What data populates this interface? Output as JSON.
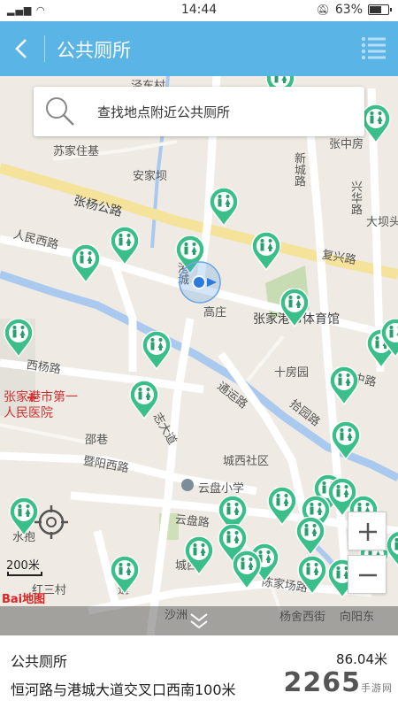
{
  "status_bar": {
    "time": "14:44",
    "battery": "63%",
    "battery_level": 0.63
  },
  "header": {
    "title": "公共厕所"
  },
  "search": {
    "placeholder": "查找地点附近公共厕所"
  },
  "map": {
    "labels": {
      "sujiazhuang": "苏家住基",
      "anjiaba": "安家坝",
      "zhangyang_rd": "张杨公路",
      "renmin_rd": "人民西路",
      "gaozhuang": "高庄",
      "stadium": "张家港市体育馆",
      "xiyang_rd": "西杨路",
      "hospital": "张家港市第一人民医院",
      "shifangyuan": "十房园",
      "tongyun_rd": "通运路",
      "bugang": "邵巷",
      "jiyang_rd": "暨阳西路",
      "chengxi": "城西社区",
      "yunpan_school": "云盘小学",
      "yunpan_rd": "云盘路",
      "chenjia": "陈家场路",
      "hongsancun": "红三村",
      "zhangzhongfang": "张中房",
      "fuxing_rd": "复兴路",
      "xincheng_rd": "新城路",
      "xingfu_rd": "兴华路",
      "dabashi": "大坝头",
      "renmin_zhong": "人民中路",
      "yangshe": "杨舍西街",
      "xiangyang": "向阳东",
      "shuiyu": "水抱",
      "chengxi_small": "城西",
      "dadao": "大道",
      "shahuan": "沙洲",
      "jiepu": "拾园路",
      "an_road": "安",
      "gangcheng": "港城",
      "zhixian": "志大道"
    },
    "scale_label": "200米",
    "logo": "Bai地图",
    "colors": {
      "pin": "#3bbf8a",
      "pin_dark": "#2a9f6e",
      "water": "#a6c8f0",
      "road": "#ffffff",
      "main_road": "#f7e49c"
    }
  },
  "result": {
    "name": "公共厕所",
    "distance": "86.04米",
    "address": "恒河路与港城大道交叉口西南100米"
  },
  "watermark": {
    "main": "2265",
    "sub": "手游网"
  }
}
